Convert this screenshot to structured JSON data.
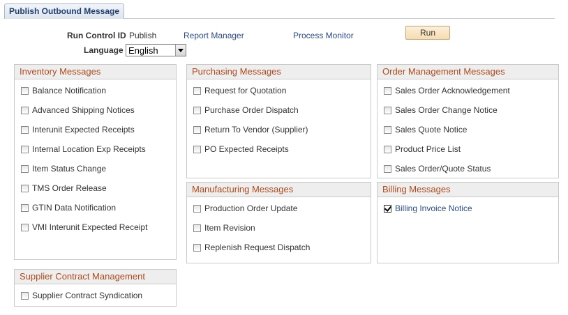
{
  "tab": {
    "label": "Publish Outbound Message"
  },
  "run_control": {
    "label": "Run Control ID",
    "value": "Publish",
    "report_manager": "Report Manager",
    "process_monitor": "Process Monitor",
    "run_button": "Run"
  },
  "language": {
    "label": "Language",
    "selected": "English"
  },
  "groups": {
    "inventory": {
      "title": "Inventory Messages",
      "items": [
        {
          "label": "Balance Notification",
          "checked": false
        },
        {
          "label": "Advanced Shipping Notices",
          "checked": false
        },
        {
          "label": "Interunit Expected Receipts",
          "checked": false
        },
        {
          "label": "Internal Location Exp Receipts",
          "checked": false
        },
        {
          "label": "Item Status Change",
          "checked": false
        },
        {
          "label": "TMS Order Release",
          "checked": false
        },
        {
          "label": "GTIN Data Notification",
          "checked": false
        },
        {
          "label": "VMI Interunit Expected Receipt",
          "checked": false
        }
      ]
    },
    "purchasing": {
      "title": "Purchasing Messages",
      "items": [
        {
          "label": "Request for Quotation",
          "checked": false
        },
        {
          "label": "Purchase Order Dispatch",
          "checked": false
        },
        {
          "label": "Return To Vendor (Supplier)",
          "checked": false
        },
        {
          "label": "PO Expected Receipts",
          "checked": false
        }
      ]
    },
    "order_management": {
      "title": "Order Management Messages",
      "items": [
        {
          "label": "Sales Order Acknowledgement",
          "checked": false
        },
        {
          "label": "Sales Order Change Notice",
          "checked": false
        },
        {
          "label": "Sales Quote Notice",
          "checked": false
        },
        {
          "label": "Product Price List",
          "checked": false
        },
        {
          "label": "Sales Order/Quote Status",
          "checked": false
        }
      ]
    },
    "manufacturing": {
      "title": "Manufacturing Messages",
      "items": [
        {
          "label": "Production Order Update",
          "checked": false
        },
        {
          "label": "Item Revision",
          "checked": false
        },
        {
          "label": "Replenish Request Dispatch",
          "checked": false
        }
      ]
    },
    "billing": {
      "title": "Billing Messages",
      "items": [
        {
          "label": "Billing Invoice Notice",
          "checked": true
        }
      ]
    },
    "supplier_contract": {
      "title": "Supplier Contract Management",
      "items": [
        {
          "label": "Supplier Contract Syndication",
          "checked": false
        }
      ]
    }
  }
}
